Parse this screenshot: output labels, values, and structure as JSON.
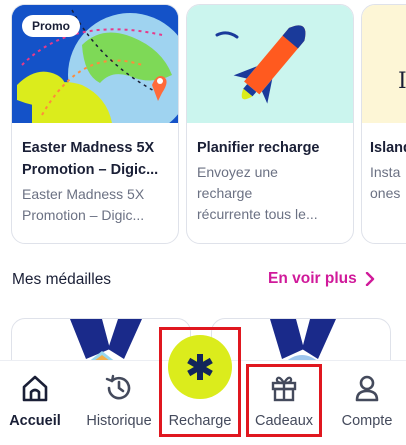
{
  "cards": [
    {
      "badge": "Promo",
      "title": "Easter Madness 5X\nPromotion – Digic...",
      "description": "Easter Madness 5X\nPromotion – Digic..."
    },
    {
      "title": "Planifier recharge",
      "description": "Envoyez une\nrecharge\nrécurrente tous le..."
    },
    {
      "art_text": "Is",
      "title": "Island",
      "description": "Insta\nones"
    }
  ],
  "medals": {
    "title": "Mes médailles",
    "see_more": "En voir plus"
  },
  "navbar": {
    "items": [
      {
        "label": "Accueil",
        "icon": "home-icon"
      },
      {
        "label": "Historique",
        "icon": "history-icon"
      },
      {
        "label": "Recharge",
        "icon": "asterisk-icon"
      },
      {
        "label": "Cadeaux",
        "icon": "gift-icon"
      },
      {
        "label": "Compte",
        "icon": "user-icon"
      }
    ]
  },
  "colors": {
    "accent_pink": "#d01a9a",
    "recharge_lime": "#dbec1c",
    "highlight_red": "#e0171f",
    "promo_blue": "#0f5bd6",
    "planifier_bg": "#cbf5ee"
  }
}
